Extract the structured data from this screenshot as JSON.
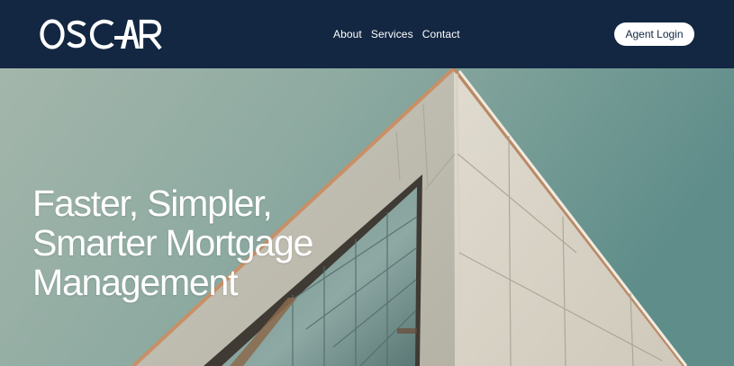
{
  "brand": {
    "name": "OSCAR",
    "nav_bg": "#132742",
    "accent": "#ffffff"
  },
  "nav": {
    "links": [
      {
        "label": "About"
      },
      {
        "label": "Services"
      },
      {
        "label": "Contact"
      }
    ],
    "login_label": "Agent Login"
  },
  "hero": {
    "title_lines": [
      "Faster, Simpler,",
      "Smarter Mortgage",
      "Management"
    ],
    "image": "modern-building-corner-photo"
  }
}
